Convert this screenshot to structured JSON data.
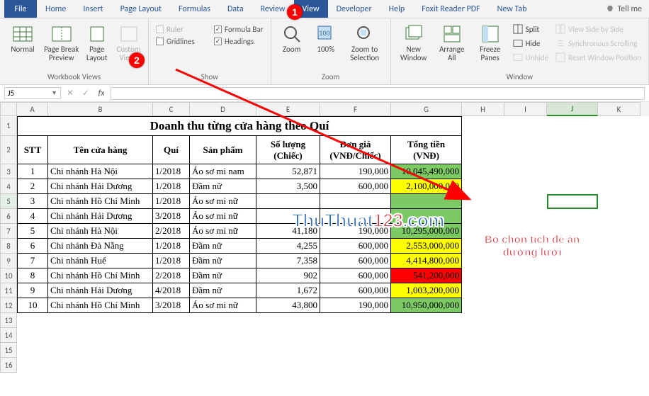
{
  "tabs": {
    "file": "File",
    "home": "Home",
    "insert": "Insert",
    "pagelayout": "Page Layout",
    "formulas": "Formulas",
    "data": "Data",
    "review": "Review",
    "view": "View",
    "developer": "Developer",
    "help": "Help",
    "foxit": "Foxit Reader PDF",
    "newtab": "New Tab",
    "tellme": "Tell me"
  },
  "ribbon": {
    "views": {
      "normal": "Normal",
      "pagebreak": "Page Break\nPreview",
      "pagelayout": "Page\nLayout",
      "custom": "Custom\nViews",
      "group": "Workbook Views"
    },
    "show": {
      "ruler": "Ruler",
      "gridlines": "Gridlines",
      "formulabar": "Formula Bar",
      "headings": "Headings",
      "group": "Show"
    },
    "zoom": {
      "zoom": "Zoom",
      "p100": "100%",
      "sel": "Zoom to\nSelection",
      "group": "Zoom"
    },
    "window": {
      "new": "New\nWindow",
      "arrange": "Arrange\nAll",
      "freeze": "Freeze\nPanes",
      "split": "Split",
      "hide": "Hide",
      "unhide": "Unhide",
      "sbs": "View Side by Side",
      "sync": "Synchronous Scrolling",
      "reset": "Reset Window Position",
      "group": "Window"
    }
  },
  "namebox": "J5",
  "cols": [
    "A",
    "B",
    "C",
    "D",
    "E",
    "F",
    "G",
    "H",
    "I",
    "J",
    "K"
  ],
  "title": "Doanh thu từng cửa hàng theo Quí",
  "headers": {
    "stt": "STT",
    "ten": "Tên cửa hàng",
    "qui": "Quí",
    "sp": "Sản phẩm",
    "sl1": "Số lượng",
    "sl2": "(Chiếc)",
    "dg1": "Đơn giá",
    "dg2": "(VNĐ/Chiếc)",
    "tt1": "Tổng tiền",
    "tt2": "(VNĐ)"
  },
  "rows": [
    {
      "stt": "1",
      "ten": "Chi nhánh Hà Nội",
      "qui": "1/2018",
      "sp": "Áo sơ mi nam",
      "sl": "52,871",
      "dg": "190,000",
      "tt": "10,045,490,000",
      "cl": "green"
    },
    {
      "stt": "2",
      "ten": "Chi nhánh Hải Dương",
      "qui": "1/2018",
      "sp": "Đầm nữ",
      "sl": "3,500",
      "dg": "600,000",
      "tt": "2,100,000,000",
      "cl": "yellow"
    },
    {
      "stt": "3",
      "ten": "Chi nhánh Hồ Chí Minh",
      "qui": "1/2018",
      "sp": "Áo sơ mi nữ",
      "sl": "",
      "dg": "",
      "tt": "",
      "cl": "green"
    },
    {
      "stt": "4",
      "ten": "Chi nhánh Hải Dương",
      "qui": "3/2018",
      "sp": "Áo sơ mi nữ",
      "sl": "",
      "dg": "",
      "tt": "",
      "cl": "green"
    },
    {
      "stt": "5",
      "ten": "Chi nhánh Hà Nội",
      "qui": "2/2018",
      "sp": "Áo sơ mi nữ",
      "sl": "41,180",
      "dg": "190,000",
      "tt": "10,295,000,000",
      "cl": "green"
    },
    {
      "stt": "6",
      "ten": "Chi nhánh Đà Nẵng",
      "qui": "1/2018",
      "sp": "Đầm nữ",
      "sl": "4,255",
      "dg": "600,000",
      "tt": "2,553,000,000",
      "cl": "yellow"
    },
    {
      "stt": "7",
      "ten": "Chi nhánh Huế",
      "qui": "1/2018",
      "sp": "Đầm nữ",
      "sl": "7,358",
      "dg": "600,000",
      "tt": "4,414,800,000",
      "cl": "yellow"
    },
    {
      "stt": "8",
      "ten": "Chi nhánh Hồ Chí Minh",
      "qui": "2/2018",
      "sp": "Đầm nữ",
      "sl": "902",
      "dg": "600,000",
      "tt": "541,200,000",
      "cl": "red"
    },
    {
      "stt": "9",
      "ten": "Chi nhánh Hải Dương",
      "qui": "4/2018",
      "sp": "Đầm nữ",
      "sl": "1,672",
      "dg": "600,000",
      "tt": "1,003,200,000",
      "cl": "yellow"
    },
    {
      "stt": "10",
      "ten": "Chi nhánh Hồ Chí Minh",
      "qui": "3/2018",
      "sp": "Áo sơ mi nữ",
      "sl": "43,800",
      "dg": "190,000",
      "tt": "10,950,000,000",
      "cl": "green"
    }
  ],
  "chart_data": {
    "type": "table",
    "title": "Doanh thu từng cửa hàng theo Quí",
    "columns": [
      "STT",
      "Tên cửa hàng",
      "Quí",
      "Sản phẩm",
      "Số lượng (Chiếc)",
      "Đơn giá (VNĐ/Chiếc)",
      "Tổng tiền (VNĐ)"
    ],
    "data": [
      [
        1,
        "Chi nhánh Hà Nội",
        "1/2018",
        "Áo sơ mi nam",
        52871,
        190000,
        10045490000
      ],
      [
        2,
        "Chi nhánh Hải Dương",
        "1/2018",
        "Đầm nữ",
        3500,
        600000,
        2100000000
      ],
      [
        3,
        "Chi nhánh Hồ Chí Minh",
        "1/2018",
        "Áo sơ mi nữ",
        null,
        null,
        null
      ],
      [
        4,
        "Chi nhánh Hải Dương",
        "3/2018",
        "Áo sơ mi nữ",
        null,
        null,
        null
      ],
      [
        5,
        "Chi nhánh Hà Nội",
        "2/2018",
        "Áo sơ mi nữ",
        41180,
        190000,
        10295000000
      ],
      [
        6,
        "Chi nhánh Đà Nẵng",
        "1/2018",
        "Đầm nữ",
        4255,
        600000,
        2553000000
      ],
      [
        7,
        "Chi nhánh Huế",
        "1/2018",
        "Đầm nữ",
        7358,
        600000,
        4414800000
      ],
      [
        8,
        "Chi nhánh Hồ Chí Minh",
        "2/2018",
        "Đầm nữ",
        902,
        600000,
        541200000
      ],
      [
        9,
        "Chi nhánh Hải Dương",
        "4/2018",
        "Đầm nữ",
        1672,
        600000,
        1003200000
      ],
      [
        10,
        "Chi nhánh Hồ Chí Minh",
        "3/2018",
        "Áo sơ mi nữ",
        43800,
        190000,
        10950000000
      ]
    ]
  },
  "marks": {
    "m1": "1",
    "m2": "2"
  },
  "watermark": {
    "a": "ThuThuat",
    "b": "123",
    "c": ".com"
  },
  "annot": "Bỏ chọn tích để ẩn\nđường lưới"
}
